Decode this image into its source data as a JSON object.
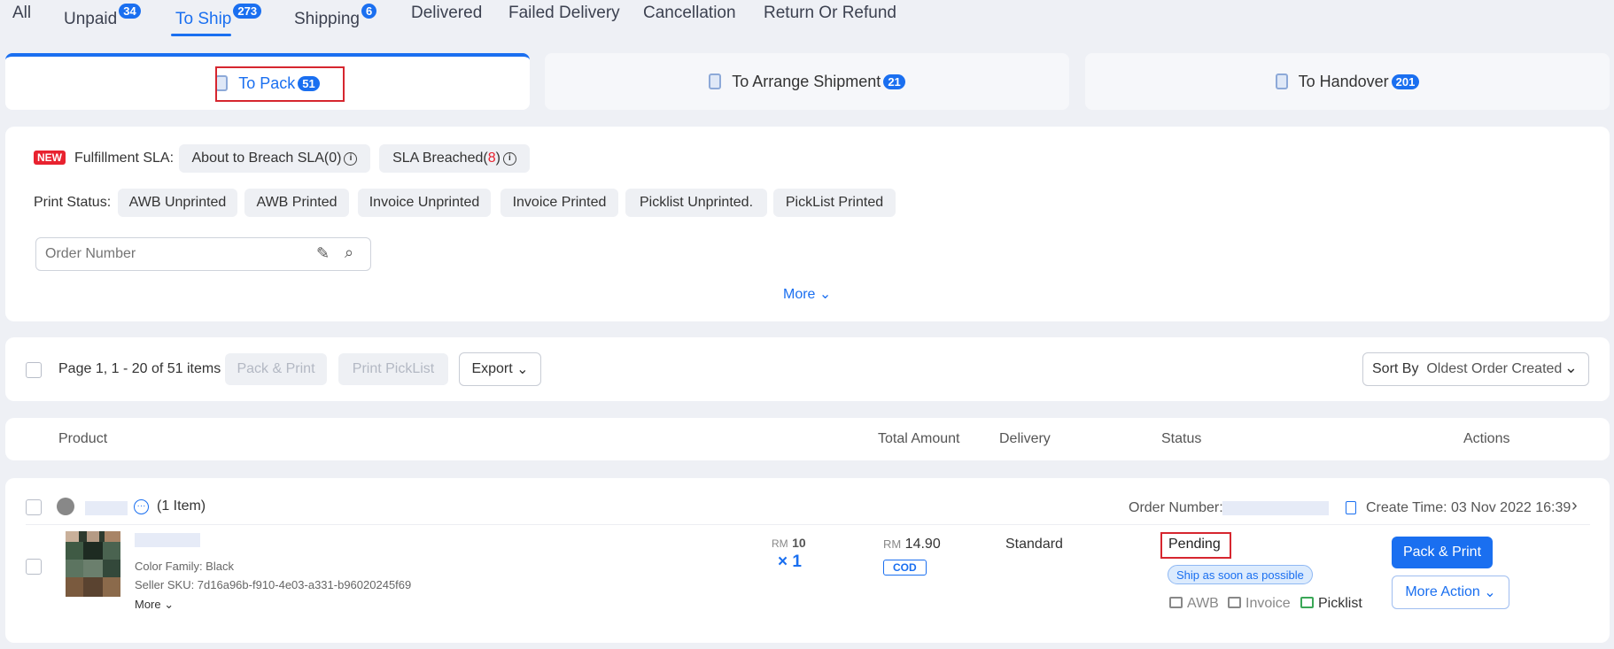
{
  "status_tabs": [
    {
      "label": "All"
    },
    {
      "label": "Unpaid",
      "count": "34"
    },
    {
      "label": "To Ship",
      "count": "273"
    },
    {
      "label": "Shipping",
      "count": "6"
    },
    {
      "label": "Delivered"
    },
    {
      "label": "Failed Delivery"
    },
    {
      "label": "Cancellation"
    },
    {
      "label": "Return Or Refund"
    }
  ],
  "sub_tabs": [
    {
      "label": "To Pack",
      "count": "51"
    },
    {
      "label": "To Arrange Shipment",
      "count": "21"
    },
    {
      "label": "To Handover",
      "count": "201"
    }
  ],
  "filters": {
    "new_badge": "NEW",
    "sla_label": "Fulfillment SLA:",
    "about_to_breach": "About to Breach SLA(0)",
    "sla_breached": "SLA Breached(",
    "sla_breached_count": "8",
    "sla_breached_close": ")",
    "print_status_label": "Print Status:",
    "print_chips": [
      "AWB Unprinted",
      "AWB Printed",
      "Invoice Unprinted",
      "Invoice Printed",
      "Picklist Unprinted.",
      "PickList Printed"
    ],
    "search_placeholder": "Order Number",
    "more": "More"
  },
  "toolbar": {
    "page_info": "Page 1, 1 - 20 of 51 items",
    "pack_print": "Pack & Print",
    "print_picklist": "Print PickList",
    "export": "Export",
    "sort_label": "Sort By",
    "sort_value": "Oldest Order Created"
  },
  "table_headers": {
    "product": "Product",
    "total_amount": "Total Amount",
    "delivery": "Delivery",
    "status": "Status",
    "actions": "Actions"
  },
  "order": {
    "item_count": "(1 Item)",
    "order_number_label": "Order Number:",
    "create_time": "Create Time: 03 Nov 2022 16:39",
    "color_family": "Color Family: Black",
    "seller_sku": "Seller SKU: 7d16a96b-f910-4e03-a331-b96020245f69",
    "more": "More",
    "unit_currency": "RM",
    "unit_price": "10",
    "quantity": "× 1",
    "total_currency": "RM",
    "total_price": "14.90",
    "payment": "COD",
    "delivery": "Standard",
    "status": "Pending",
    "ship_tag": "Ship as soon as possible",
    "awb": "AWB",
    "invoice": "Invoice",
    "picklist": "Picklist",
    "pack_print": "Pack & Print",
    "more_action": "More Action"
  }
}
